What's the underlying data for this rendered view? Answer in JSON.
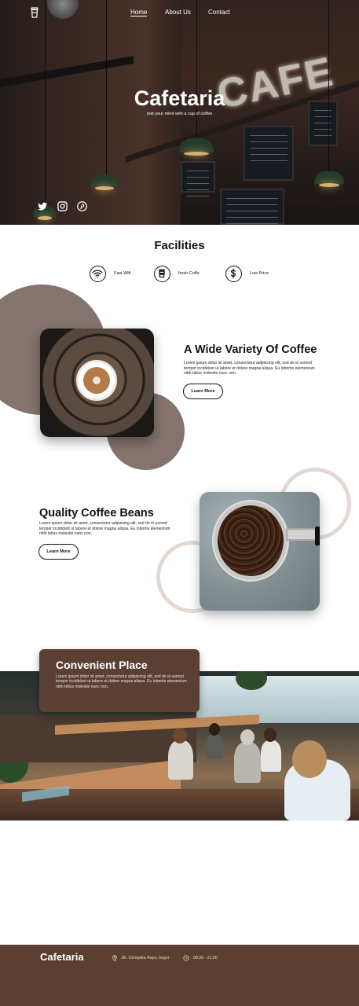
{
  "nav": {
    "items": [
      "Home",
      "About Us",
      "Contact"
    ]
  },
  "hero": {
    "title": "Cafetaria",
    "subtitle": "rest your mind with a cup of coffee",
    "sign_text": "CAFE",
    "socials": [
      "twitter-icon",
      "instagram-icon",
      "pinterest-icon"
    ]
  },
  "facilities": {
    "title": "Facilities",
    "items": [
      {
        "label": "Fast Wifi",
        "icon": "wifi-icon"
      },
      {
        "label": "fresh Coffe",
        "icon": "coffee-cup-icon"
      },
      {
        "label": "Low Price",
        "icon": "dollar-icon"
      }
    ]
  },
  "sections": {
    "variety": {
      "title": "A Wide Variety Of Coffee",
      "body": "Lorem ipsum dolor sit amet, consectetur adipiscing elit, sed do ei usmod tempor incididunt ut labore et dolore magna aliqua. Eu lobortis elementum nibh tellus molestie nunc non.",
      "button": "Learn More"
    },
    "beans": {
      "title": "Quality Coffee Beans",
      "body": "Lorem ipsum dolor sit amet, consectetur adipiscing elit, sed do ei usmod tempor incididunt ut labore et dolore magna aliqua. Eu lobortis elementum nibh tellus molestie nunc non.",
      "button": "Learn More"
    },
    "place": {
      "title": "Convenient Place",
      "body": "Lorem ipsum dolor sit amet, consectetur adipiscing elit, sed do ei usmod tempor incididunt ut labore et dolore magna aliqua. Eu lobortis elementum nibh tellus molestie nunc non."
    }
  },
  "footer": {
    "brand": "Cafetaria",
    "address": "Jln. Cempaka Raya, bogor",
    "hours": "08.00 - 21.00"
  },
  "colors": {
    "brown": "#5a3e30",
    "taupe": "#85736d",
    "ring": "#e2d9d5"
  }
}
